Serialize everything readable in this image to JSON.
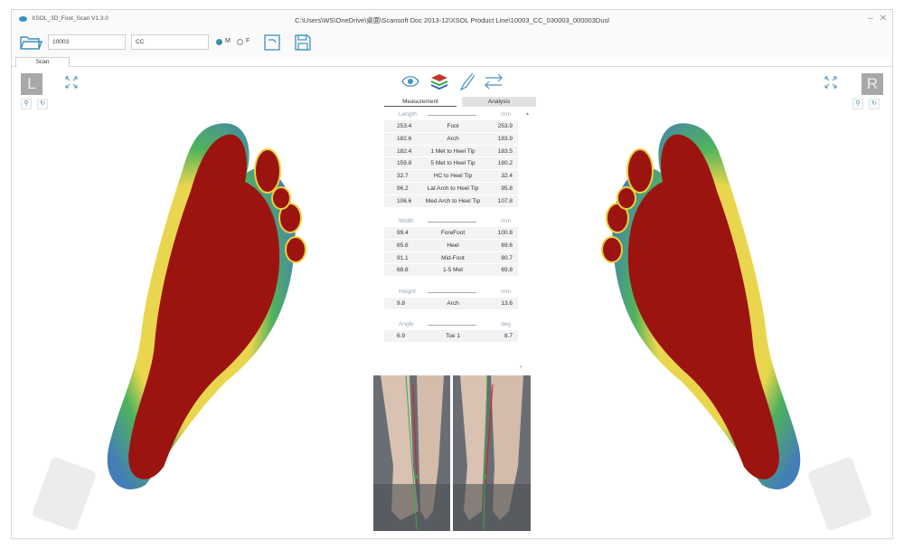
{
  "window": {
    "app_title": "XSOL_3D_Foot_Scan V1.3.0",
    "path_title": "C:\\Users\\WS\\OneDrive\\桌面\\Scansoft Doc 2013-12\\XSOL Product Line\\10003_CC_030003_000003Dusl",
    "minimize_label": "–",
    "close_label": "✕"
  },
  "toolbar": {
    "id_value": "10003",
    "name_value": "CC",
    "gender_m_label": "M",
    "gender_f_label": "F",
    "gender_selected": "M"
  },
  "tabs": [
    {
      "label": "Scan"
    }
  ],
  "sides": {
    "left_letter": "L",
    "right_letter": "R"
  },
  "panel": {
    "tab_measurement": "Measurement",
    "tab_analysis": "Analysis",
    "sections": [
      {
        "name": "Length",
        "unit": "mm",
        "rows": [
          {
            "left": "253.4",
            "label": "Foot",
            "right": "253.9"
          },
          {
            "left": "182.6",
            "label": "Arch",
            "right": "183.9"
          },
          {
            "left": "182.4",
            "label": "1 Met to Heel Tip",
            "right": "183.5"
          },
          {
            "left": "159.8",
            "label": "5 Met to Heel Tip",
            "right": "160.2"
          },
          {
            "left": "32.7",
            "label": "HC to Heel Tip",
            "right": "32.4"
          },
          {
            "left": "96.2",
            "label": "Lat Arch to Heel Tip",
            "right": "95.8"
          },
          {
            "left": "106.6",
            "label": "Med Arch to Heel Tip",
            "right": "107.8"
          }
        ]
      },
      {
        "name": "Width",
        "unit": "mm",
        "rows": [
          {
            "left": "99.4",
            "label": "ForeFoot",
            "right": "100.8"
          },
          {
            "left": "65.6",
            "label": "Heel",
            "right": "69.6"
          },
          {
            "left": "91.1",
            "label": "Mid-Foot",
            "right": "80.7"
          },
          {
            "left": "68.8",
            "label": "1-5 Met",
            "right": "69.8"
          }
        ]
      },
      {
        "name": "Height",
        "unit": "mm",
        "rows": [
          {
            "left": "9.8",
            "label": "Arch",
            "right": "13.6"
          }
        ]
      },
      {
        "name": "Angle",
        "unit": "deg",
        "rows": [
          {
            "left": "6.9",
            "label": "Toe 1",
            "right": "8.7"
          }
        ]
      }
    ]
  },
  "colors": {
    "heat_red": "#9c1410",
    "heat_yellow": "#e8d23a",
    "heat_green": "#3caa4a",
    "heat_blue": "#2e6fb0",
    "accent": "#3a8fc0"
  },
  "icons": [
    "folder-icon",
    "eye-icon",
    "layers-icon",
    "brush-icon",
    "swap-icon",
    "export-icon",
    "save-icon",
    "expand-icon",
    "filter-icon",
    "refresh-icon"
  ]
}
